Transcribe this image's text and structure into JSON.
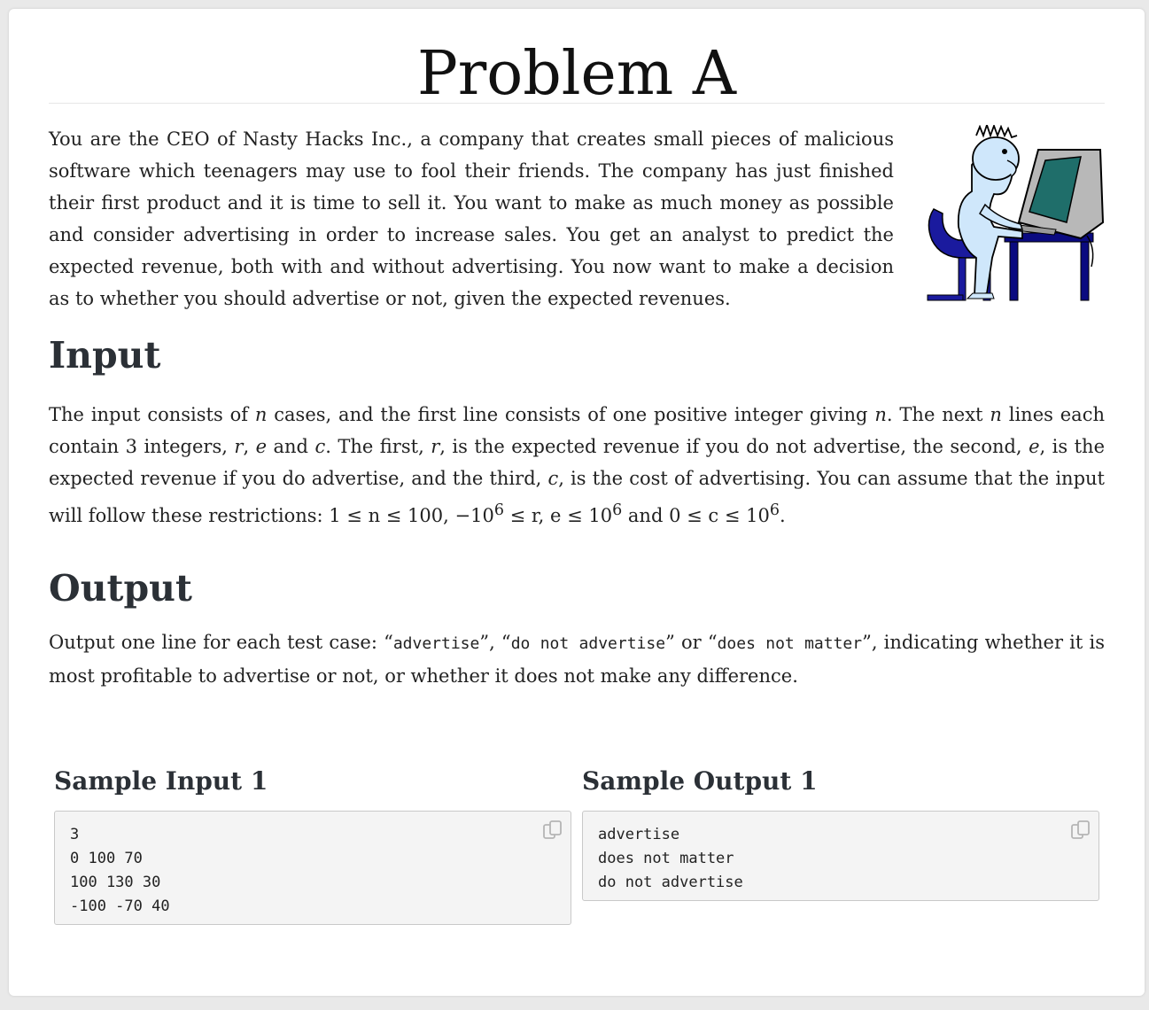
{
  "title": "Problem A",
  "intro": "You are the CEO of Nasty Hacks Inc., a company that creates small pieces of malicious software which teenagers may use to fool their friends. The company has just finished their first product and it is time to sell it. You want to make as much money as possible and consider advertising in order to increase sales. You get an analyst to predict the expected revenue, both with and without advertising. You now want to make a decision as to whether you should advertise or not, given the expected revenues.",
  "illustration_icon": "person-at-computer-illustration",
  "input": {
    "heading": "Input",
    "t1": "The input consists of ",
    "n1": "n",
    "t2": " cases, and the first line consists of one positive integer giving ",
    "n2": "n",
    "t3": ". The next ",
    "n3": "n",
    "t4": " lines each contain ",
    "three": "3",
    "t5": " integers, ",
    "r1": "r",
    "comma1": ", ",
    "e1": "e",
    "and1": " and ",
    "c1": "c",
    "t6": ". The first, ",
    "r2": "r",
    "t7": ", is the expected revenue if you do not advertise, the second, ",
    "e2": "e",
    "t8": ", is the expected revenue if you do advertise, and the third, ",
    "c2": "c",
    "t9": ", is the cost of advertising. You can assume that the input will follow these restrictions: ",
    "m1": "1 ≤ n ≤ 100",
    "comma2": ", ",
    "m2": "−10",
    "m2sup": "6",
    "m3": " ≤ r, e ≤ 10",
    "m3sup": "6",
    "and2": " and ",
    "m4": "0 ≤ c ≤ 10",
    "m4sup": "6",
    "end": "."
  },
  "output": {
    "heading": "Output",
    "t1": "Output one line for each test case: “",
    "c1": "advertise",
    "t2": "”, “",
    "c2": "do not advertise",
    "t3": "” or “",
    "c3": "does not matter",
    "t4": "”, indicating whether it is most profitable to advertise or not, or whether it does not make any difference."
  },
  "sample_input": {
    "heading": "Sample Input 1",
    "content": "3\n0 100 70\n100 130 30\n-100 -70 40"
  },
  "sample_output": {
    "heading": "Sample Output 1",
    "content": "advertise\ndoes not matter\ndo not advertise"
  },
  "copy_icon": "copy-icon"
}
